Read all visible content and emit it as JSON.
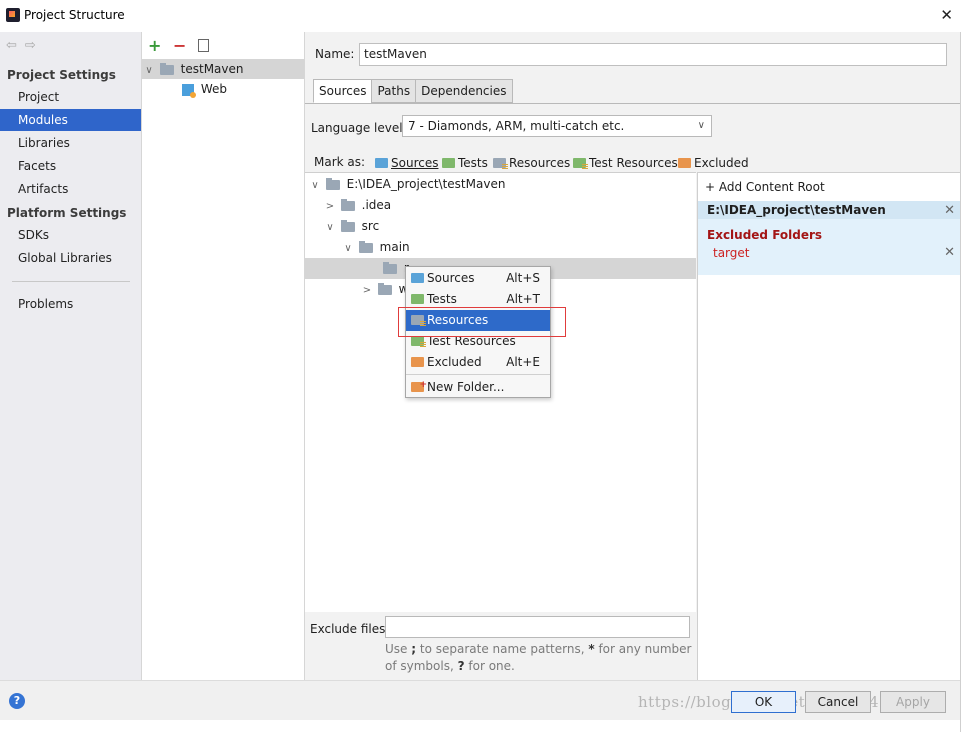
{
  "window": {
    "title": "Project Structure",
    "close_glyph": "✕"
  },
  "nav": {
    "arrows": "⇦⇨",
    "project_settings_header": "Project Settings",
    "project_settings": [
      "Project",
      "Modules",
      "Libraries",
      "Facets",
      "Artifacts"
    ],
    "platform_settings_header": "Platform Settings",
    "platform_settings": [
      "SDKs",
      "Global Libraries"
    ],
    "problems": "Problems",
    "selected": "Modules"
  },
  "modules": {
    "toolbar": {
      "add": "+",
      "remove": "−"
    },
    "tree": [
      {
        "label": "testMaven",
        "expanded": true,
        "selected": true
      },
      {
        "label": "Web"
      }
    ]
  },
  "editor": {
    "name_label": "Name:",
    "name_value": "testMaven",
    "tabs": [
      "Sources",
      "Paths",
      "Dependencies"
    ],
    "active_tab": "Sources",
    "language_level_label": "Language level:",
    "language_level_value": "7 - Diamonds, ARM, multi-catch etc.",
    "mark_as_label": "Mark as:",
    "mark_as": [
      "Sources",
      "Tests",
      "Resources",
      "Test Resources",
      "Excluded"
    ],
    "tree": [
      {
        "label": "E:\\IDEA_project\\testMaven",
        "chevron": "∨"
      },
      {
        "label": ".idea",
        "chevron": ">"
      },
      {
        "label": "src",
        "chevron": "∨"
      },
      {
        "label": "main",
        "chevron": "∨"
      },
      {
        "label": "r",
        "selected": true
      },
      {
        "label": "w",
        "chevron": ">"
      }
    ],
    "add_content_root": "+ Add Content Root",
    "content_root_path": "E:\\IDEA_project\\testMaven",
    "excluded_folders_header": "Excluded Folders",
    "excluded_folders": [
      "target"
    ],
    "exclude_files_label": "Exclude files:",
    "exclude_files_value": "",
    "exclude_hint_1": "Use ",
    "exclude_hint_semicolon": ";",
    "exclude_hint_2": " to separate name patterns, ",
    "exclude_hint_star": "*",
    "exclude_hint_3": " for any number of symbols, ",
    "exclude_hint_q": "?",
    "exclude_hint_4": " for one."
  },
  "context_menu": {
    "items": [
      {
        "label": "Sources",
        "shortcut": "Alt+S"
      },
      {
        "label": "Tests",
        "shortcut": "Alt+T"
      },
      {
        "label": "Resources",
        "shortcut": "",
        "highlighted": true
      },
      {
        "label": "Test Resources",
        "shortcut": ""
      },
      {
        "label": "Excluded",
        "shortcut": "Alt+E"
      },
      {
        "label": "New Folder...",
        "shortcut": ""
      }
    ]
  },
  "footer": {
    "help": "?",
    "ok": "OK",
    "cancel": "Cancel",
    "apply": "Apply",
    "watermark": "https://blog.csdn.net/qq_37840130"
  },
  "colors": {
    "selection_blue": "#2f65ca",
    "menu_highlight": "#2e6ac9",
    "annotation_red": "#e03c3c",
    "excluded_header": "#a31515"
  }
}
